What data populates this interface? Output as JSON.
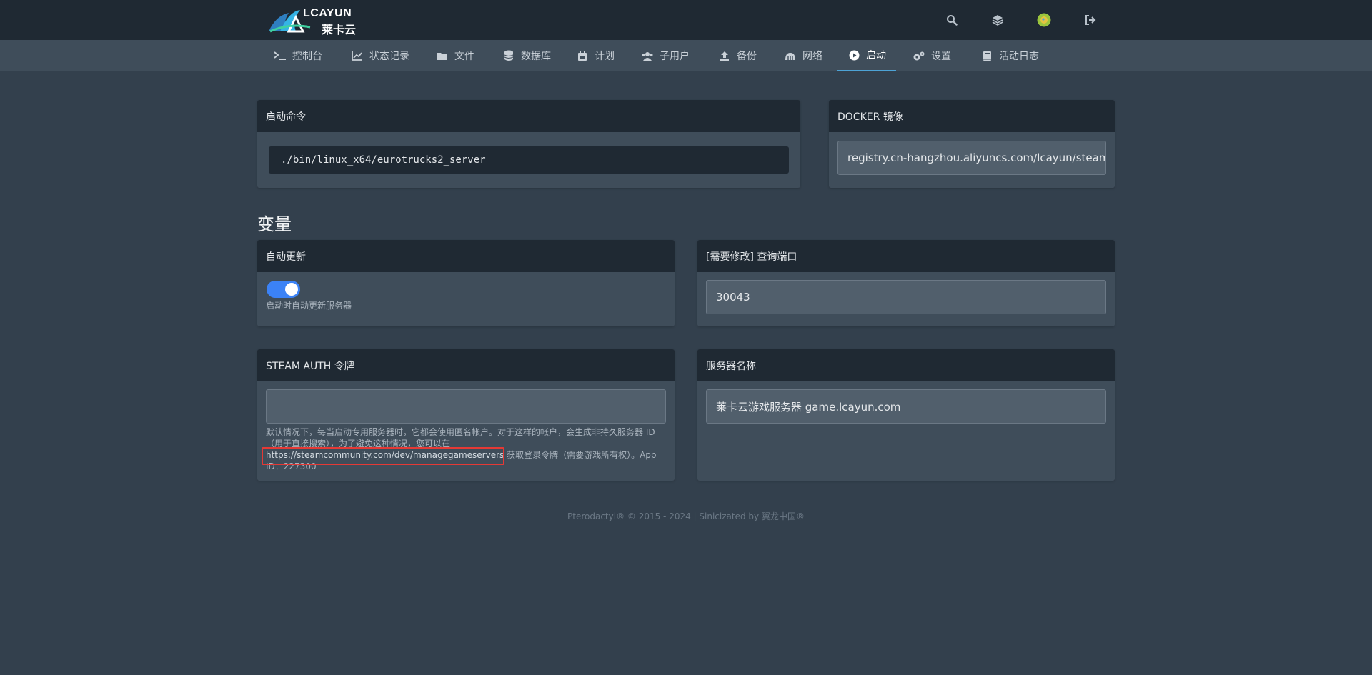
{
  "header": {
    "logo_text": "LCAYUN",
    "logo_cn": "莱卡云"
  },
  "nav": {
    "items": [
      {
        "label": "控制台",
        "icon": "terminal-icon"
      },
      {
        "label": "状态记录",
        "icon": "chart-line-icon"
      },
      {
        "label": "文件",
        "icon": "folder-icon"
      },
      {
        "label": "数据库",
        "icon": "database-icon"
      },
      {
        "label": "计划",
        "icon": "calendar-icon"
      },
      {
        "label": "子用户",
        "icon": "users-icon"
      },
      {
        "label": "备份",
        "icon": "upload-icon"
      },
      {
        "label": "网络",
        "icon": "network-icon"
      },
      {
        "label": "启动",
        "icon": "play-circle-icon",
        "active": true
      },
      {
        "label": "设置",
        "icon": "cogs-icon"
      },
      {
        "label": "活动日志",
        "icon": "book-icon"
      }
    ]
  },
  "startup": {
    "command_title": "启动命令",
    "command": "./bin/linux_x64/eurotrucks2_server",
    "docker_title": "DOCKER 镜像",
    "docker_image": "registry.cn-hangzhou.aliyuncs.com/lcayun/steamcmd"
  },
  "variables": {
    "title": "变量",
    "auto_update": {
      "title": "自动更新",
      "enabled": true,
      "desc": "启动时自动更新服务器"
    },
    "query_port": {
      "title": "[需要修改] 查询端口",
      "value": "30043"
    },
    "steam_auth": {
      "title": "STEAM AUTH 令牌",
      "value": "",
      "desc_line1": "默认情况下，每当启动专用服务器时，它都会使用匿名帐户。对于这样的帐户，会生成非持久服务器 ID",
      "desc_line2": "（用于直接搜索），为了避免这种情况，您可以在",
      "desc_link": "https://steamcommunity.com/dev/managegameservers",
      "desc_line3_rest": " 获取登录令牌（需要游戏所有权）。App",
      "desc_line4": "ID：227300"
    },
    "server_name": {
      "title": "服务器名称",
      "value": "莱卡云游戏服务器 game.lcayun.com"
    }
  },
  "footer": {
    "text": "Pterodactyl® © 2015 - 2024 | Sinicizated by 翼龙中国®"
  },
  "colors": {
    "accent": "#4da3d6",
    "toggle_on": "#3b82f6",
    "highlight_box": "#e53935"
  }
}
